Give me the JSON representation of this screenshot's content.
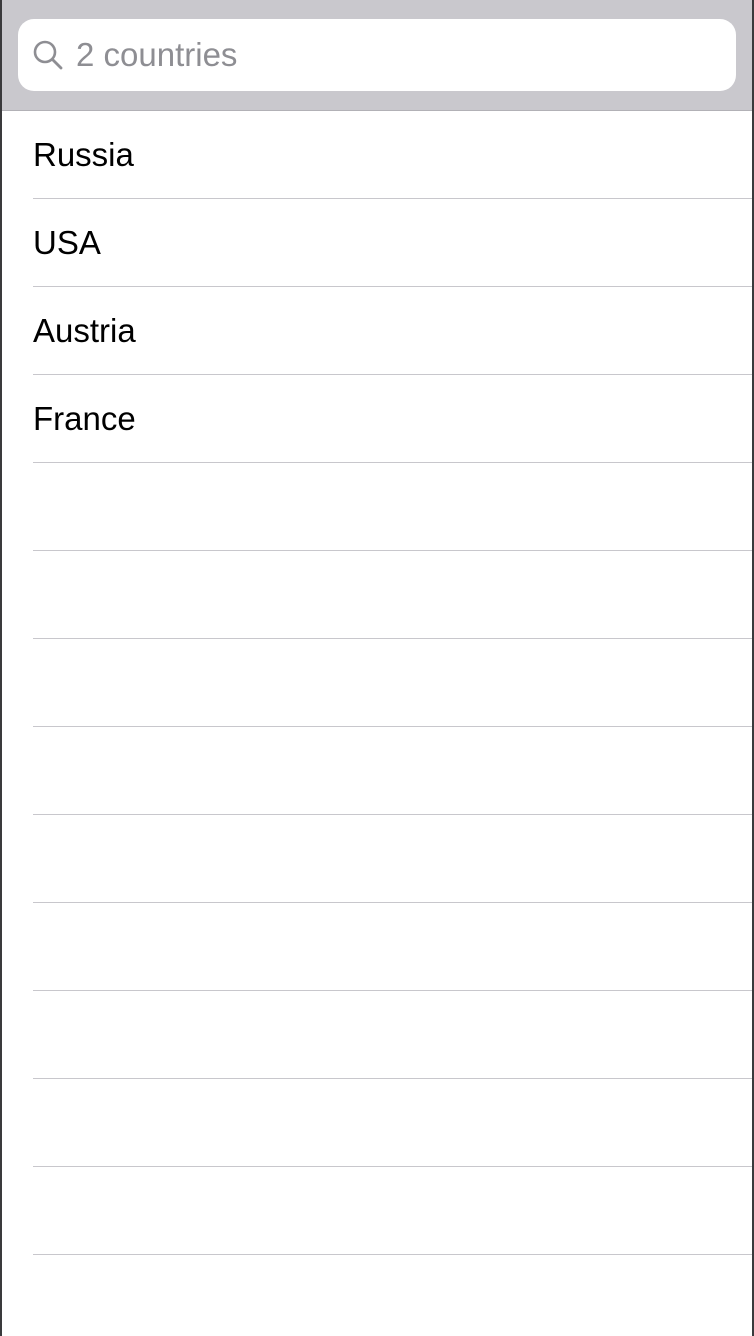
{
  "search": {
    "placeholder": "2 countries",
    "value": ""
  },
  "icons": {
    "search": "search-icon"
  },
  "colors": {
    "search_bar_background": "#c9c8cd",
    "placeholder": "#8e8e93",
    "separator": "#c8c7cc",
    "text": "#000000"
  },
  "list": {
    "items": [
      {
        "label": "Russia"
      },
      {
        "label": "USA"
      },
      {
        "label": "Austria"
      },
      {
        "label": "France"
      }
    ],
    "empty_rows": 10
  }
}
